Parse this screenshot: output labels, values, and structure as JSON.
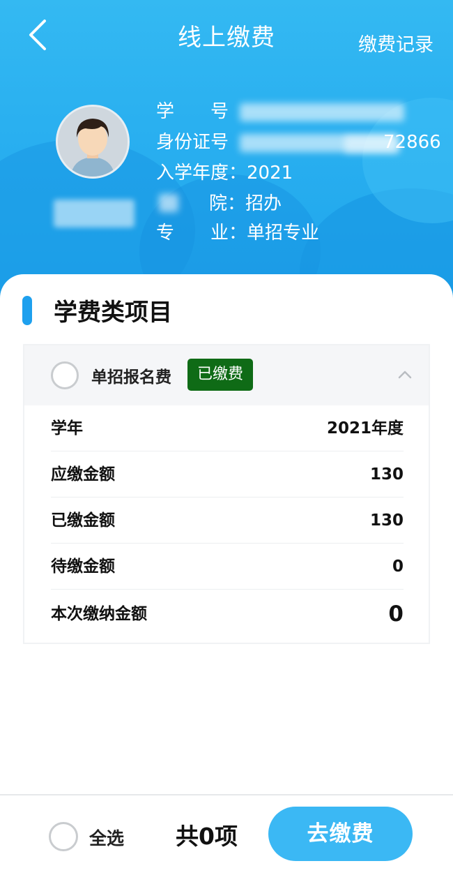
{
  "header": {
    "back_icon": "chevron-left-icon",
    "title": "线上缴费",
    "record_link": "缴费记录"
  },
  "profile": {
    "avatar_icon": "user-avatar-icon",
    "rows": [
      {
        "label": "学　　号",
        "value": ""
      },
      {
        "label": "身份证号",
        "value": "72866"
      },
      {
        "label": "入学年度：",
        "value": "2021"
      },
      {
        "label": "院：",
        "value": "招办"
      },
      {
        "label": "专　　业：",
        "value": "单招专业"
      }
    ]
  },
  "section": {
    "title": "学费类项目"
  },
  "fee_item": {
    "name": "单招报名费",
    "status_badge": "已缴费",
    "expand_icon": "chevron-up-icon",
    "rows": [
      {
        "label": "学年",
        "value": "2021年度"
      },
      {
        "label": "应缴金额",
        "value": "130"
      },
      {
        "label": "已缴金额",
        "value": "130"
      },
      {
        "label": "待缴金额",
        "value": "0"
      },
      {
        "label": "本次缴纳金额",
        "value": "0"
      }
    ]
  },
  "footer": {
    "select_all": "全选",
    "count_text": "共0项",
    "pay_button": "去缴费"
  },
  "colors": {
    "header_blue": "#2ab0f0",
    "accent": "#1ea0ee",
    "badge_green": "#0f6b16",
    "pay_button": "#3bb8f4"
  }
}
